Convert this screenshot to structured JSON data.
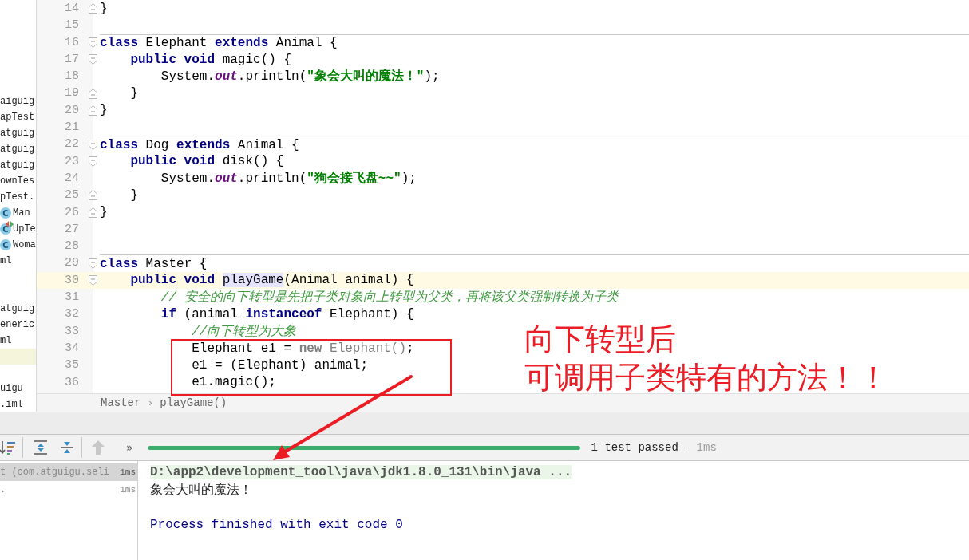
{
  "project_tree": {
    "items": [
      {
        "kind": "file",
        "label": "aiguig",
        "highlighted": false
      },
      {
        "kind": "file",
        "label": "apTest",
        "highlighted": false
      },
      {
        "kind": "file",
        "label": "atguig",
        "highlighted": false
      },
      {
        "kind": "file",
        "label": "atguig",
        "highlighted": false
      },
      {
        "kind": "file",
        "label": "atguig",
        "highlighted": false
      },
      {
        "kind": "file",
        "label": "ownTes",
        "highlighted": false
      },
      {
        "kind": "file",
        "label": "pTest.",
        "highlighted": false
      },
      {
        "kind": "class",
        "badge": "C",
        "label": "Man",
        "runnable": false,
        "highlighted": false
      },
      {
        "kind": "class",
        "badge": "C",
        "label": "UpTe",
        "runnable": true,
        "highlighted": false
      },
      {
        "kind": "class",
        "badge": "C",
        "label": "Woma",
        "runnable": false,
        "highlighted": false
      },
      {
        "kind": "file",
        "label": "ml",
        "highlighted": false
      },
      {
        "kind": "blank",
        "highlighted": false
      },
      {
        "kind": "blank",
        "highlighted": false
      },
      {
        "kind": "file",
        "label": "atguig",
        "highlighted": false
      },
      {
        "kind": "file",
        "label": "eneric",
        "highlighted": false
      },
      {
        "kind": "file",
        "label": "ml",
        "highlighted": false
      },
      {
        "kind": "blank",
        "highlighted": true
      },
      {
        "kind": "blank",
        "highlighted": false
      },
      {
        "kind": "file",
        "label": "uigu",
        "highlighted": false
      },
      {
        "kind": "file",
        "label": ".iml",
        "highlighted": false
      }
    ]
  },
  "editor": {
    "lines": [
      {
        "number": "14",
        "fold_end": true,
        "tokens": [
          {
            "kind": "plain",
            "text": "}"
          }
        ]
      },
      {
        "number": "15"
      },
      {
        "number": "16",
        "fold_start": true,
        "separator_above": true,
        "tokens": [
          {
            "kind": "keyword",
            "text": "class"
          },
          {
            "kind": "plain",
            "text": " Elephant "
          },
          {
            "kind": "keyword",
            "text": "extends"
          },
          {
            "kind": "plain",
            "text": " Animal {"
          }
        ]
      },
      {
        "number": "17",
        "fold_start": true,
        "tokens": [
          {
            "kind": "keyword",
            "text": "    public void"
          },
          {
            "kind": "plain",
            "text": " magic() {"
          }
        ]
      },
      {
        "number": "18",
        "tokens": [
          {
            "kind": "plain",
            "text": "        System."
          },
          {
            "kind": "static",
            "text": "out"
          },
          {
            "kind": "plain",
            "text": ".println("
          },
          {
            "kind": "string",
            "text": "\"象会大叫的魔法！\""
          },
          {
            "kind": "plain",
            "text": ");"
          }
        ]
      },
      {
        "number": "19",
        "fold_end": true,
        "tokens": [
          {
            "kind": "plain",
            "text": "    }"
          }
        ]
      },
      {
        "number": "20",
        "fold_end": true,
        "tokens": [
          {
            "kind": "plain",
            "text": "}"
          }
        ]
      },
      {
        "number": "21"
      },
      {
        "number": "22",
        "fold_start": true,
        "separator_above": true,
        "tokens": [
          {
            "kind": "keyword",
            "text": "class"
          },
          {
            "kind": "plain",
            "text": " Dog "
          },
          {
            "kind": "keyword",
            "text": "extends"
          },
          {
            "kind": "plain",
            "text": " Animal {"
          }
        ]
      },
      {
        "number": "23",
        "fold_start": true,
        "tokens": [
          {
            "kind": "keyword",
            "text": "    public void"
          },
          {
            "kind": "plain",
            "text": " disk() {"
          }
        ]
      },
      {
        "number": "24",
        "tokens": [
          {
            "kind": "plain",
            "text": "        System."
          },
          {
            "kind": "static",
            "text": "out"
          },
          {
            "kind": "plain",
            "text": ".println("
          },
          {
            "kind": "string",
            "text": "\"狗会接飞盘~~\""
          },
          {
            "kind": "plain",
            "text": ");"
          }
        ]
      },
      {
        "number": "25",
        "fold_end": true,
        "tokens": [
          {
            "kind": "plain",
            "text": "    }"
          }
        ]
      },
      {
        "number": "26",
        "fold_end": true,
        "tokens": [
          {
            "kind": "plain",
            "text": "}"
          }
        ]
      },
      {
        "number": "27"
      },
      {
        "number": "28"
      },
      {
        "number": "29",
        "fold_start": true,
        "separator_above": true,
        "tokens": [
          {
            "kind": "keyword",
            "text": "class"
          },
          {
            "kind": "plain",
            "text": " Master {"
          }
        ]
      },
      {
        "number": "30",
        "fold_start": true,
        "caret": true,
        "tokens": [
          {
            "kind": "keyword",
            "text": "    public void "
          },
          {
            "kind": "usage",
            "text": "playGame"
          },
          {
            "kind": "plain",
            "text": "(Animal animal) {"
          }
        ]
      },
      {
        "number": "31",
        "tokens": [
          {
            "kind": "comment",
            "text": "        // 安全的向下转型是先把子类对象向上转型为父类，再将该父类强制转换为子类"
          }
        ]
      },
      {
        "number": "32",
        "tokens": [
          {
            "kind": "keyword",
            "text": "        if"
          },
          {
            "kind": "plain",
            "text": " (animal "
          },
          {
            "kind": "keyword",
            "text": "instanceof"
          },
          {
            "kind": "plain",
            "text": " Elephant) {"
          }
        ]
      },
      {
        "number": "33",
        "tokens": [
          {
            "kind": "comment",
            "text": "            //向下转型为大象"
          }
        ]
      },
      {
        "number": "34",
        "tokens": [
          {
            "kind": "plain",
            "text": "            Elephant e1 = "
          },
          {
            "kind": "unused_keyword",
            "text": "new"
          },
          {
            "kind": "unused",
            "text": " Elephant()"
          },
          {
            "kind": "plain",
            "text": ";"
          }
        ]
      },
      {
        "number": "35",
        "tokens": [
          {
            "kind": "plain",
            "text": "            e1 = (Elephant) animal;"
          }
        ]
      },
      {
        "number": "36",
        "tokens": [
          {
            "kind": "plain",
            "text": "            e1.magic();"
          }
        ]
      }
    ]
  },
  "breadcrumb": {
    "items": [
      "Master",
      "playGame()"
    ],
    "separator": "›"
  },
  "run_toolbar": {
    "more": "»",
    "progress": {
      "level": 1
    },
    "status": "1 test passed",
    "duration": "– 1ms"
  },
  "test_tree": [
    {
      "label": "t (com.atguigu.seli",
      "time": "1ms",
      "selected": true
    },
    {
      "label": ".",
      "time": "1ms",
      "selected": false
    }
  ],
  "console": [
    {
      "kind": "command",
      "text": "D:\\app2\\development_tool\\java\\jdk1.8.0_131\\bin\\java ..."
    },
    {
      "kind": "output",
      "text": "象会大叫的魔法！"
    },
    {
      "kind": "blank"
    },
    {
      "kind": "system",
      "text": "Process finished with exit code 0"
    }
  ],
  "callout": [
    "向下转型后",
    "可调用子类特有的方法！！"
  ]
}
